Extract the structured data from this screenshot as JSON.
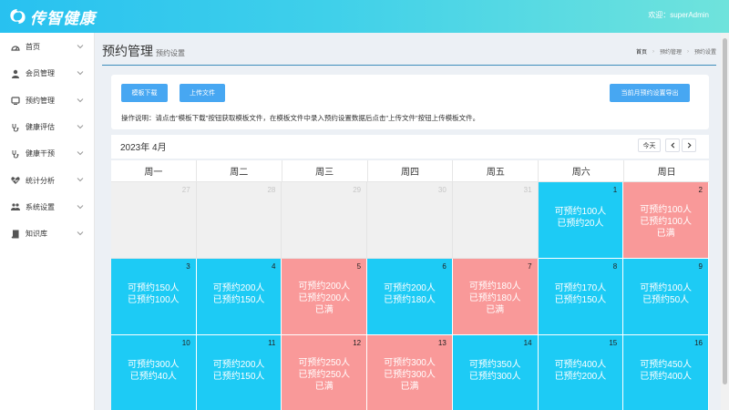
{
  "header": {
    "logo_text": "传智健康",
    "welcome_text": "欢迎：superAdmin",
    "logo_icon": "swirl-logo-icon"
  },
  "sidebar": {
    "items": [
      {
        "label": "首页",
        "icon": "dashboard-icon"
      },
      {
        "label": "会员管理",
        "icon": "user-icon"
      },
      {
        "label": "预约管理",
        "icon": "tv-icon"
      },
      {
        "label": "健康评估",
        "icon": "stethoscope-icon"
      },
      {
        "label": "健康干预",
        "icon": "stethoscope-icon"
      },
      {
        "label": "统计分析",
        "icon": "heartbeat-icon"
      },
      {
        "label": "系统设置",
        "icon": "users-icon"
      },
      {
        "label": "知识库",
        "icon": "book-icon"
      }
    ]
  },
  "page": {
    "title": "预约管理",
    "subtitle": "预约设置",
    "breadcrumb": [
      "首页",
      "预约管理",
      "预约设置"
    ]
  },
  "toolbar": {
    "template_btn": "模板下载",
    "upload_btn": "上传文件",
    "export_btn": "当前月预约设置导出",
    "instructions": "操作说明：请点击\"模板下载\"按钮获取模板文件，在模板文件中录入预约设置数据后点击\"上传文件\"按钮上传模板文件。"
  },
  "calendar": {
    "month_label": "2023年 4月",
    "today_btn": "今天",
    "weekdays": [
      "周一",
      "周二",
      "周三",
      "周四",
      "周五",
      "周六",
      "周日"
    ],
    "days": [
      {
        "num": "27",
        "state": "empty",
        "lines": []
      },
      {
        "num": "28",
        "state": "empty",
        "lines": []
      },
      {
        "num": "29",
        "state": "empty",
        "lines": []
      },
      {
        "num": "30",
        "state": "empty",
        "lines": []
      },
      {
        "num": "31",
        "state": "empty",
        "lines": []
      },
      {
        "num": "1",
        "state": "avail",
        "lines": [
          "可预约100人",
          "已预约20人"
        ]
      },
      {
        "num": "2",
        "state": "full",
        "lines": [
          "可预约100人",
          "已预约100人",
          "已满"
        ]
      },
      {
        "num": "3",
        "state": "avail",
        "lines": [
          "可预约150人",
          "已预约100人"
        ]
      },
      {
        "num": "4",
        "state": "avail",
        "lines": [
          "可预约200人",
          "已预约150人"
        ]
      },
      {
        "num": "5",
        "state": "full",
        "lines": [
          "可预约200人",
          "已预约200人",
          "已满"
        ]
      },
      {
        "num": "6",
        "state": "avail",
        "lines": [
          "可预约200人",
          "已预约180人"
        ]
      },
      {
        "num": "7",
        "state": "full",
        "lines": [
          "可预约180人",
          "已预约180人",
          "已满"
        ]
      },
      {
        "num": "8",
        "state": "avail",
        "lines": [
          "可预约170人",
          "已预约150人"
        ]
      },
      {
        "num": "9",
        "state": "avail",
        "lines": [
          "可预约100人",
          "已预约50人"
        ]
      },
      {
        "num": "10",
        "state": "avail",
        "lines": [
          "可预约300人",
          "已预约40人"
        ]
      },
      {
        "num": "11",
        "state": "avail",
        "lines": [
          "可预约200人",
          "已预约150人"
        ]
      },
      {
        "num": "12",
        "state": "full",
        "lines": [
          "可预约250人",
          "已预约250人",
          "已满"
        ]
      },
      {
        "num": "13",
        "state": "full",
        "lines": [
          "可预约300人",
          "已预约300人",
          "已满"
        ]
      },
      {
        "num": "14",
        "state": "avail",
        "lines": [
          "可预约350人",
          "已预约300人"
        ]
      },
      {
        "num": "15",
        "state": "avail",
        "lines": [
          "可预约400人",
          "已预约200人"
        ]
      },
      {
        "num": "16",
        "state": "avail",
        "lines": [
          "可预约450人",
          "已预约400人"
        ]
      }
    ]
  },
  "colors": {
    "header_start": "#28c1f0",
    "header_end": "#6fe3dc",
    "available": "#1dcbf5",
    "full": "#f99999",
    "button": "#47a7f2"
  }
}
